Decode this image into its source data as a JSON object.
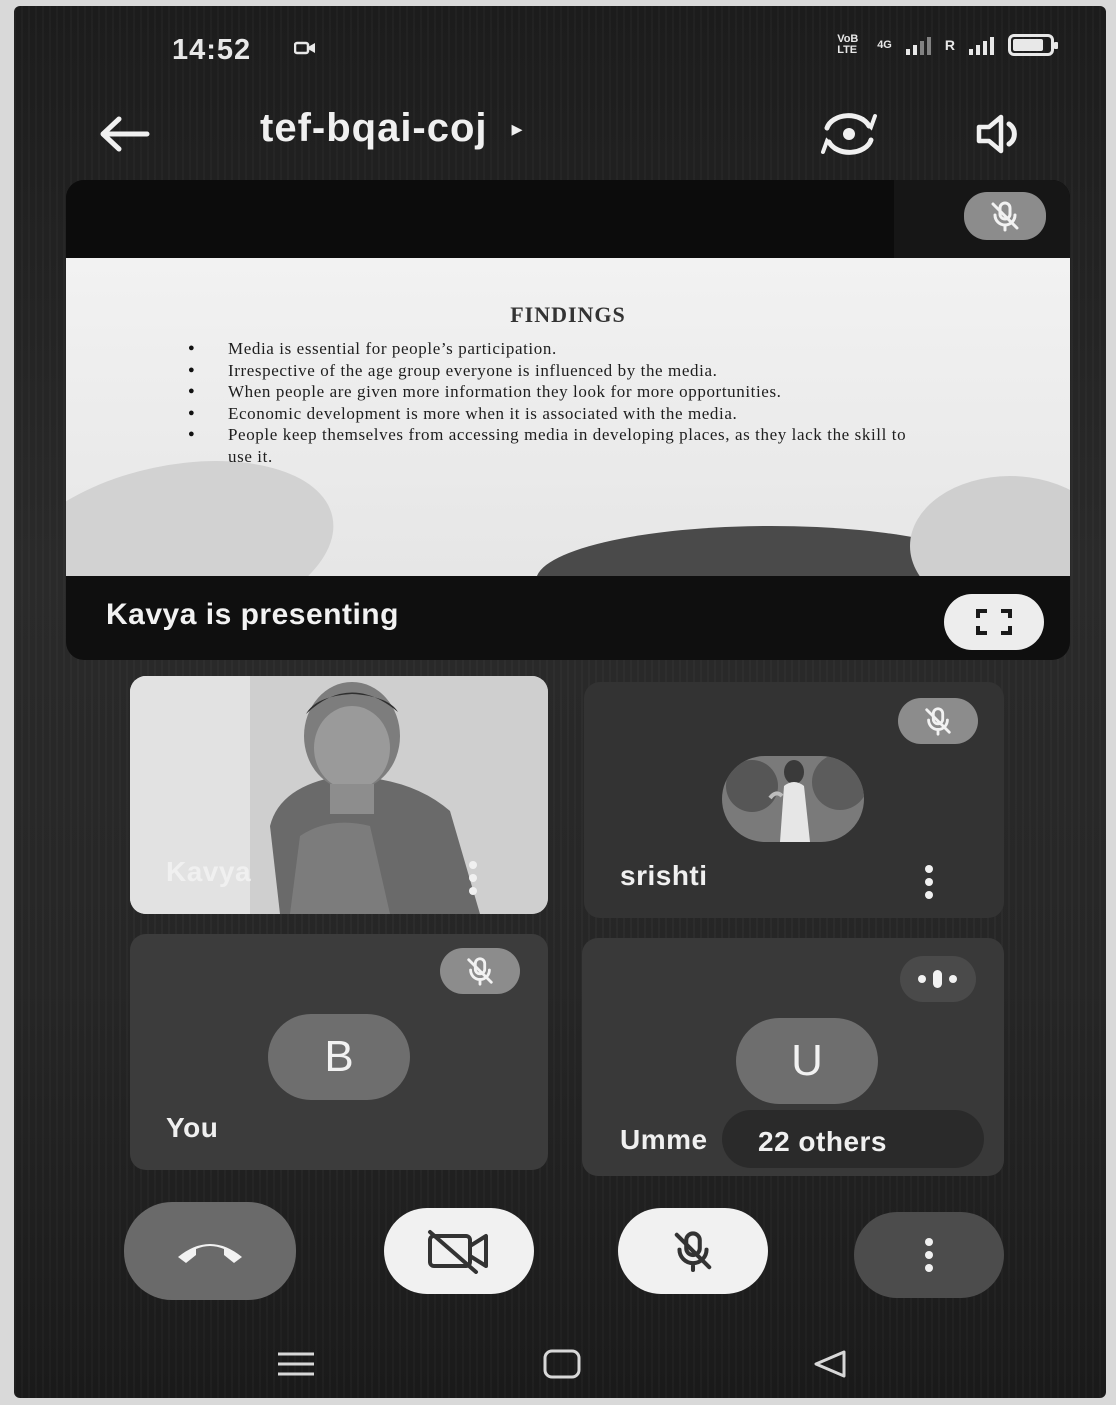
{
  "status_bar": {
    "time": "14:52",
    "network_label": "VoB LTE",
    "data_type": "4G",
    "roaming": "R",
    "icons": [
      "camera-recording-icon",
      "signal-icon",
      "battery-icon"
    ]
  },
  "app_bar": {
    "meeting_code": "tef-bqai-coj",
    "caret": "▸",
    "icons": [
      "back-arrow-icon",
      "switch-camera-icon",
      "speaker-icon"
    ]
  },
  "presentation": {
    "slide_title": "FINDINGS",
    "bullets": [
      "Media is essential for people’s participation.",
      "Irrespective of the age group everyone is influenced by the media.",
      "When people are given more information they look for more opportunities.",
      "Economic development is more when it is associated with the media.",
      "People keep themselves from accessing media in developing places, as they lack the skill to use it."
    ],
    "presenting_text": "Kavya is presenting"
  },
  "participants": {
    "kavya": {
      "name": "Kavya"
    },
    "srishti": {
      "name": "srishti",
      "muted": true
    },
    "you": {
      "name": "You",
      "initial": "B",
      "muted": true
    },
    "umme": {
      "name": "Umme",
      "initial": "U",
      "others": "22 others",
      "speaking": true
    }
  },
  "controls": {
    "icons": [
      "end-call-icon",
      "camera-off-icon",
      "mic-off-icon",
      "more-vert-icon"
    ]
  },
  "nav": {
    "icons": [
      "recents-icon",
      "home-icon",
      "back-icon"
    ]
  },
  "colors": {
    "background": "#1f1f1f",
    "tile": "#3b3b3b",
    "control_light": "#f1f1f1",
    "end_call": "#6a6a6a"
  }
}
